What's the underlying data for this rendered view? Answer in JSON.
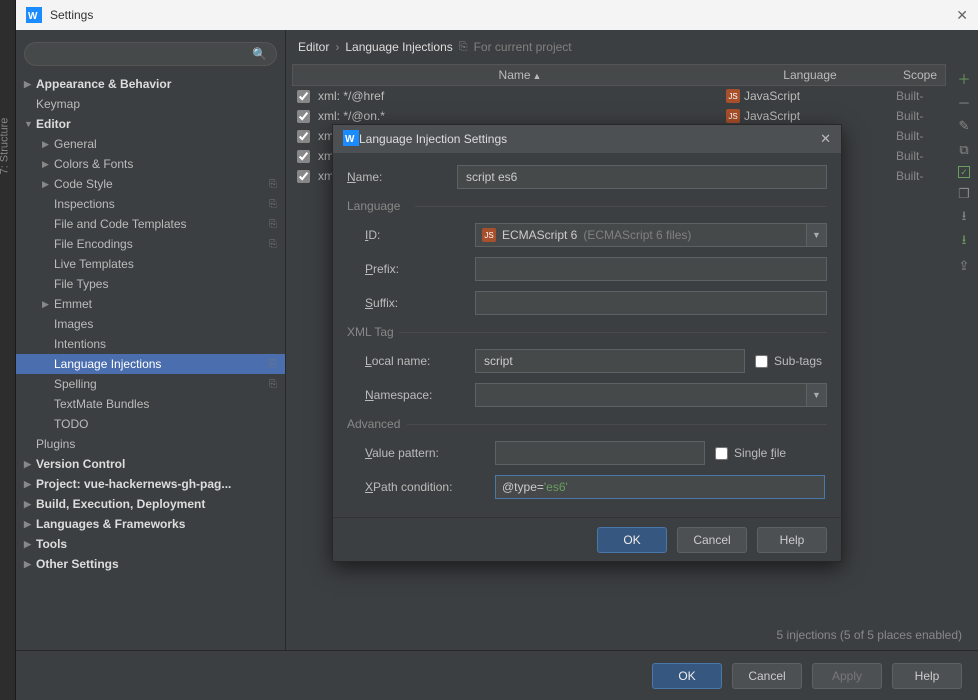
{
  "leftStrip": {
    "label": "7: Structure"
  },
  "titlebar": {
    "title": "Settings"
  },
  "sidebar": {
    "items": [
      {
        "label": "Appearance & Behavior",
        "arrow": true,
        "bold": true,
        "indent": 0
      },
      {
        "label": "Keymap",
        "arrow": false,
        "bold": false,
        "indent": 0
      },
      {
        "label": "Editor",
        "arrow": true,
        "bold": true,
        "indent": 0,
        "open": true
      },
      {
        "label": "General",
        "arrow": true,
        "indent": 1
      },
      {
        "label": "Colors & Fonts",
        "arrow": true,
        "indent": 1
      },
      {
        "label": "Code Style",
        "arrow": true,
        "indent": 1,
        "copy": true
      },
      {
        "label": "Inspections",
        "arrow": false,
        "indent": 1,
        "copy": true
      },
      {
        "label": "File and Code Templates",
        "arrow": false,
        "indent": 1,
        "copy": true
      },
      {
        "label": "File Encodings",
        "arrow": false,
        "indent": 1,
        "copy": true
      },
      {
        "label": "Live Templates",
        "arrow": false,
        "indent": 1
      },
      {
        "label": "File Types",
        "arrow": false,
        "indent": 1
      },
      {
        "label": "Emmet",
        "arrow": true,
        "indent": 1
      },
      {
        "label": "Images",
        "arrow": false,
        "indent": 1
      },
      {
        "label": "Intentions",
        "arrow": false,
        "indent": 1
      },
      {
        "label": "Language Injections",
        "arrow": false,
        "indent": 1,
        "copy": true,
        "selected": true
      },
      {
        "label": "Spelling",
        "arrow": false,
        "indent": 1,
        "copy": true
      },
      {
        "label": "TextMate Bundles",
        "arrow": false,
        "indent": 1
      },
      {
        "label": "TODO",
        "arrow": false,
        "indent": 1
      },
      {
        "label": "Plugins",
        "arrow": false,
        "bold": false,
        "indent": 0
      },
      {
        "label": "Version Control",
        "arrow": true,
        "bold": true,
        "indent": 0
      },
      {
        "label": "Project: vue-hackernews-gh-pag...",
        "arrow": true,
        "bold": true,
        "indent": 0
      },
      {
        "label": "Build, Execution, Deployment",
        "arrow": true,
        "bold": true,
        "indent": 0
      },
      {
        "label": "Languages & Frameworks",
        "arrow": true,
        "bold": true,
        "indent": 0
      },
      {
        "label": "Tools",
        "arrow": true,
        "bold": true,
        "indent": 0
      },
      {
        "label": "Other Settings",
        "arrow": true,
        "bold": true,
        "indent": 0
      }
    ]
  },
  "breadcrumb": {
    "root": "Editor",
    "leaf": "Language Injections",
    "note": "For current project"
  },
  "table": {
    "head": {
      "name": "Name",
      "lang": "Language",
      "scope": "Scope"
    },
    "rows": [
      {
        "checked": true,
        "name": "xml: */@href",
        "lang": "JavaScript",
        "scope": "Built-"
      },
      {
        "checked": true,
        "name": "xml: */@on.*",
        "lang": "JavaScript",
        "scope": "Built-"
      },
      {
        "checked": true,
        "name": "xm",
        "lang": "",
        "scope": "Built-"
      },
      {
        "checked": true,
        "name": "xm",
        "lang": "",
        "scope": "Built-"
      },
      {
        "checked": true,
        "name": "xm",
        "lang": "",
        "scope": "Built-"
      }
    ]
  },
  "status": "5 injections (5 of 5 places enabled)",
  "footer": {
    "ok": "OK",
    "cancel": "Cancel",
    "apply": "Apply",
    "help": "Help"
  },
  "dialog": {
    "title": "Language Injection Settings",
    "name_label": "Name:",
    "name_value": "script es6",
    "section_lang": "Language",
    "id_label": "ID:",
    "id_value": "ECMAScript 6",
    "id_hint": "(ECMAScript 6 files)",
    "prefix_label": "Prefix:",
    "prefix_value": "",
    "suffix_label": "Suffix:",
    "suffix_value": "",
    "section_xml": "XML Tag",
    "localname_label": "Local name:",
    "localname_value": "script",
    "subtags_label": "Sub-tags",
    "namespace_label": "Namespace:",
    "section_adv": "Advanced",
    "valuepat_label": "Value pattern:",
    "valuepat_value": "",
    "singlefile_label": "Single file",
    "xpath_label": "XPath condition:",
    "xpath_key": "@type=",
    "xpath_str": "'es6'",
    "ok": "OK",
    "cancel": "Cancel",
    "help": "Help"
  }
}
